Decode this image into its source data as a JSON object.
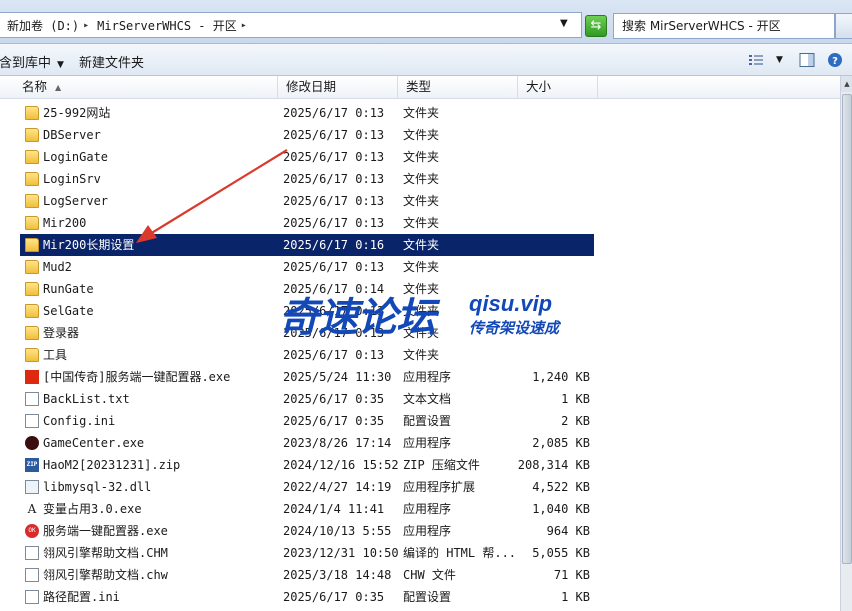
{
  "address": {
    "crumbs": [
      "新加卷 (D:)",
      "MirServerWHCS - 开区"
    ],
    "search_placeholder": "搜索 MirServerWHCS - 开区"
  },
  "toolbar": {
    "include_label": "包含到库中",
    "new_folder_label": "新建文件夹"
  },
  "columns": {
    "name": "名称",
    "date": "修改日期",
    "type": "类型",
    "size": "大小"
  },
  "files": [
    {
      "name": "25-992网站",
      "date": "2025/6/17 0:13",
      "type": "文件夹",
      "size": "",
      "icon": "folder-icon"
    },
    {
      "name": "DBServer",
      "date": "2025/6/17 0:13",
      "type": "文件夹",
      "size": "",
      "icon": "folder-icon"
    },
    {
      "name": "LoginGate",
      "date": "2025/6/17 0:13",
      "type": "文件夹",
      "size": "",
      "icon": "folder-icon"
    },
    {
      "name": "LoginSrv",
      "date": "2025/6/17 0:13",
      "type": "文件夹",
      "size": "",
      "icon": "folder-icon"
    },
    {
      "name": "LogServer",
      "date": "2025/6/17 0:13",
      "type": "文件夹",
      "size": "",
      "icon": "folder-icon"
    },
    {
      "name": "Mir200",
      "date": "2025/6/17 0:13",
      "type": "文件夹",
      "size": "",
      "icon": "folder-icon"
    },
    {
      "name": "Mir200长期设置",
      "date": "2025/6/17 0:16",
      "type": "文件夹",
      "size": "",
      "icon": "folder-icon",
      "selected": true
    },
    {
      "name": "Mud2",
      "date": "2025/6/17 0:13",
      "type": "文件夹",
      "size": "",
      "icon": "folder-icon"
    },
    {
      "name": "RunGate",
      "date": "2025/6/17 0:14",
      "type": "文件夹",
      "size": "",
      "icon": "folder-icon"
    },
    {
      "name": "SelGate",
      "date": "2025/6/17 0:13",
      "type": "文件夹",
      "size": "",
      "icon": "folder-icon"
    },
    {
      "name": "登录器",
      "date": "2025/6/17 0:13",
      "type": "文件夹",
      "size": "",
      "icon": "folder-icon"
    },
    {
      "name": "工具",
      "date": "2025/6/17 0:13",
      "type": "文件夹",
      "size": "",
      "icon": "folder-icon"
    },
    {
      "name": "[中国传奇]服务端一键配置器.exe",
      "date": "2025/5/24 11:30",
      "type": "应用程序",
      "size": "1,240 KB",
      "icon": "china-flag-icon"
    },
    {
      "name": "BackList.txt",
      "date": "2025/6/17 0:35",
      "type": "文本文档",
      "size": "1 KB",
      "icon": "text-file-icon"
    },
    {
      "name": "Config.ini",
      "date": "2025/6/17 0:35",
      "type": "配置设置",
      "size": "2 KB",
      "icon": "config-file-icon"
    },
    {
      "name": "GameCenter.exe",
      "date": "2023/8/26 17:14",
      "type": "应用程序",
      "size": "2,085 KB",
      "icon": "game-app-icon"
    },
    {
      "name": "HaoM2[20231231].zip",
      "date": "2024/12/16 15:52",
      "type": "ZIP 压缩文件",
      "size": "208,314 KB",
      "icon": "zip-file-icon"
    },
    {
      "name": "libmysql-32.dll",
      "date": "2022/4/27 14:19",
      "type": "应用程序扩展",
      "size": "4,522 KB",
      "icon": "dll-file-icon"
    },
    {
      "name": "变量占用3.0.exe",
      "date": "2024/1/4 11:41",
      "type": "应用程序",
      "size": "1,040 KB",
      "icon": "font-app-icon"
    },
    {
      "name": "服务端一键配置器.exe",
      "date": "2024/10/13 5:55",
      "type": "应用程序",
      "size": "964 KB",
      "icon": "logo-app-icon"
    },
    {
      "name": "翎风引擎帮助文档.CHM",
      "date": "2023/12/31 10:50",
      "type": "编译的 HTML 帮...",
      "size": "5,055 KB",
      "icon": "chm-file-icon"
    },
    {
      "name": "翎风引擎帮助文档.chw",
      "date": "2025/3/18 14:48",
      "type": "CHW 文件",
      "size": "71 KB",
      "icon": "blank-file-icon"
    },
    {
      "name": "路径配置.ini",
      "date": "2025/6/17 0:35",
      "type": "配置设置",
      "size": "1 KB",
      "icon": "config-file-icon"
    }
  ],
  "watermark": {
    "brand": "奇速论坛",
    "url": "qisu.vip",
    "tagline": "传奇架设速成"
  },
  "colors": {
    "selection": "#0a246a",
    "watermark": "#1248b8",
    "arrow": "#d93a2b"
  }
}
